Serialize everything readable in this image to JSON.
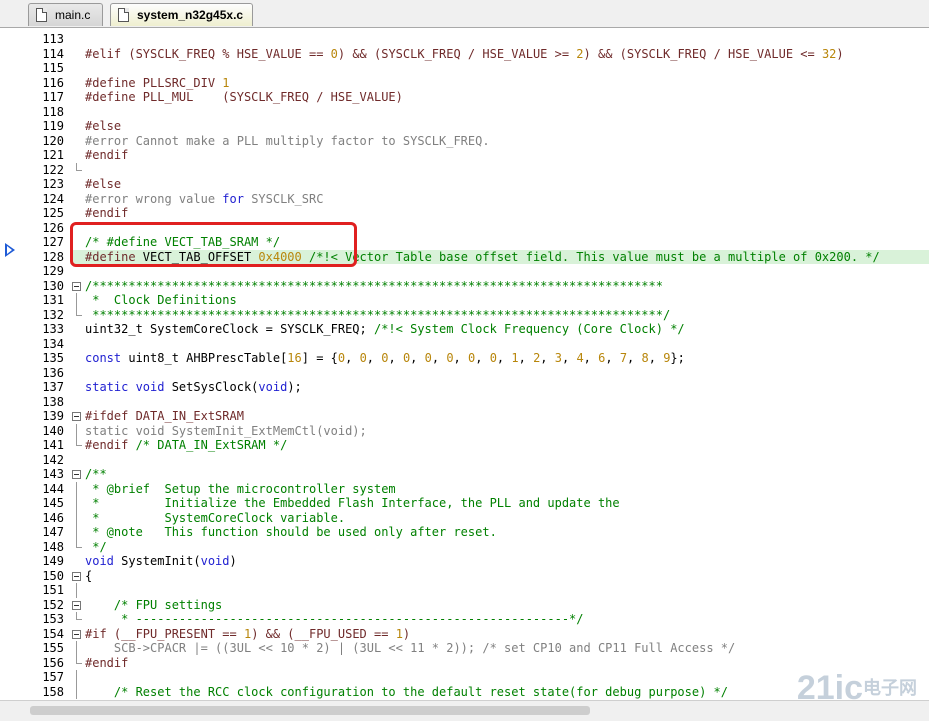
{
  "tabs": [
    {
      "label": "main.c",
      "active": false
    },
    {
      "label": "system_n32g45x.c",
      "active": true
    }
  ],
  "watermark": {
    "brand": "21ic",
    "cn": "电子网"
  },
  "highlight_line": 128,
  "lines": [
    {
      "n": "113",
      "segs": []
    },
    {
      "n": "114",
      "segs": [
        [
          "pp",
          "#elif (SYSCLK_FREQ % HSE_VALUE == "
        ],
        [
          "nm",
          "0"
        ],
        [
          "pp",
          ") && (SYSCLK_FREQ / HSE_VALUE >= "
        ],
        [
          "nm",
          "2"
        ],
        [
          "pp",
          ") && (SYSCLK_FREQ / HSE_VALUE <= "
        ],
        [
          "nm",
          "32"
        ],
        [
          "pp",
          ")"
        ]
      ]
    },
    {
      "n": "115",
      "segs": []
    },
    {
      "n": "116",
      "segs": [
        [
          "pp",
          "#define PLLSRC_DIV "
        ],
        [
          "nm",
          "1"
        ]
      ]
    },
    {
      "n": "117",
      "segs": [
        [
          "pp",
          "#define PLL_MUL    (SYSCLK_FREQ / HSE_VALUE)"
        ]
      ]
    },
    {
      "n": "118",
      "segs": []
    },
    {
      "n": "119",
      "segs": [
        [
          "pp",
          "#else"
        ]
      ]
    },
    {
      "n": "120",
      "segs": [
        [
          "gray",
          "#error Cannot make a PLL multiply factor to SYSCLK_FREQ."
        ]
      ]
    },
    {
      "n": "121",
      "segs": [
        [
          "pp",
          "#endif"
        ]
      ]
    },
    {
      "n": "122",
      "segs": []
    },
    {
      "n": "123",
      "segs": [
        [
          "pp",
          "#else"
        ]
      ]
    },
    {
      "n": "124",
      "segs": [
        [
          "gray",
          "#error wrong value "
        ],
        [
          "kw",
          "for"
        ],
        [
          "gray",
          " SYSCLK_SRC"
        ]
      ]
    },
    {
      "n": "125",
      "segs": [
        [
          "pp",
          "#endif"
        ]
      ]
    },
    {
      "n": "126",
      "segs": []
    },
    {
      "n": "127",
      "segs": [
        [
          "cm",
          "/* #define VECT_TAB_SRAM */"
        ]
      ]
    },
    {
      "n": "128",
      "segs": [
        [
          "pp",
          "#define "
        ],
        [
          "",
          "VECT_TAB_OFFSET "
        ],
        [
          "nm",
          "0x4000"
        ],
        [
          "cm",
          " /*!< Vector Table base offset field. This value must be a multiple of 0x200. */"
        ]
      ]
    },
    {
      "n": "129",
      "segs": []
    },
    {
      "n": "130",
      "segs": [
        [
          "cm",
          "/*******************************************************************************"
        ]
      ]
    },
    {
      "n": "131",
      "segs": [
        [
          "cm",
          " *  Clock Definitions"
        ]
      ]
    },
    {
      "n": "132",
      "segs": [
        [
          "cm",
          " *******************************************************************************/"
        ]
      ]
    },
    {
      "n": "133",
      "segs": [
        [
          "",
          "uint32_t SystemCoreClock = SYSCLK_FREQ; "
        ],
        [
          "cm",
          "/*!< System Clock Frequency (Core Clock) */"
        ]
      ]
    },
    {
      "n": "134",
      "segs": []
    },
    {
      "n": "135",
      "segs": [
        [
          "kw",
          "const"
        ],
        [
          "",
          " uint8_t AHBPrescTable["
        ],
        [
          "nm",
          "16"
        ],
        [
          "",
          "] = {"
        ],
        [
          "nm",
          "0"
        ],
        [
          "",
          ", "
        ],
        [
          "nm",
          "0"
        ],
        [
          "",
          ", "
        ],
        [
          "nm",
          "0"
        ],
        [
          "",
          ", "
        ],
        [
          "nm",
          "0"
        ],
        [
          "",
          ", "
        ],
        [
          "nm",
          "0"
        ],
        [
          "",
          ", "
        ],
        [
          "nm",
          "0"
        ],
        [
          "",
          ", "
        ],
        [
          "nm",
          "0"
        ],
        [
          "",
          ", "
        ],
        [
          "nm",
          "0"
        ],
        [
          "",
          ", "
        ],
        [
          "nm",
          "1"
        ],
        [
          "",
          ", "
        ],
        [
          "nm",
          "2"
        ],
        [
          "",
          ", "
        ],
        [
          "nm",
          "3"
        ],
        [
          "",
          ", "
        ],
        [
          "nm",
          "4"
        ],
        [
          "",
          ", "
        ],
        [
          "nm",
          "6"
        ],
        [
          "",
          ", "
        ],
        [
          "nm",
          "7"
        ],
        [
          "",
          ", "
        ],
        [
          "nm",
          "8"
        ],
        [
          "",
          ", "
        ],
        [
          "nm",
          "9"
        ],
        [
          "",
          "};"
        ]
      ]
    },
    {
      "n": "136",
      "segs": []
    },
    {
      "n": "137",
      "segs": [
        [
          "kw",
          "static void"
        ],
        [
          "",
          " SetSysClock("
        ],
        [
          "kw",
          "void"
        ],
        [
          "",
          ");"
        ]
      ]
    },
    {
      "n": "138",
      "segs": []
    },
    {
      "n": "139",
      "segs": [
        [
          "pp",
          "#ifdef DATA_IN_ExtSRAM"
        ]
      ]
    },
    {
      "n": "140",
      "segs": [
        [
          "gray",
          "static void SystemInit_ExtMemCtl(void);"
        ]
      ]
    },
    {
      "n": "141",
      "segs": [
        [
          "pp",
          "#endif "
        ],
        [
          "cm",
          "/* DATA_IN_ExtSRAM */"
        ]
      ]
    },
    {
      "n": "142",
      "segs": []
    },
    {
      "n": "143",
      "segs": [
        [
          "cm",
          "/**"
        ]
      ]
    },
    {
      "n": "144",
      "segs": [
        [
          "cm",
          " * @brief  Setup the microcontroller system"
        ]
      ]
    },
    {
      "n": "145",
      "segs": [
        [
          "cm",
          " *         Initialize the Embedded Flash Interface, the PLL and update the"
        ]
      ]
    },
    {
      "n": "146",
      "segs": [
        [
          "cm",
          " *         SystemCoreClock variable."
        ]
      ]
    },
    {
      "n": "147",
      "segs": [
        [
          "cm",
          " * @note   This function should be used only after reset."
        ]
      ]
    },
    {
      "n": "148",
      "segs": [
        [
          "cm",
          " */"
        ]
      ]
    },
    {
      "n": "149",
      "segs": [
        [
          "kw",
          "void"
        ],
        [
          "",
          " SystemInit("
        ],
        [
          "kw",
          "void"
        ],
        [
          "",
          ")"
        ]
      ]
    },
    {
      "n": "150",
      "segs": [
        [
          "",
          "{"
        ]
      ]
    },
    {
      "n": "151",
      "segs": []
    },
    {
      "n": "152",
      "segs": [
        [
          "cm",
          "    /* FPU settings"
        ]
      ]
    },
    {
      "n": "153",
      "segs": [
        [
          "cm",
          "     * ------------------------------------------------------------*/"
        ]
      ]
    },
    {
      "n": "154",
      "segs": [
        [
          "pp",
          "#if (__FPU_PRESENT == "
        ],
        [
          "nm",
          "1"
        ],
        [
          "pp",
          ") && (__FPU_USED == "
        ],
        [
          "nm",
          "1"
        ],
        [
          "pp",
          ")"
        ]
      ]
    },
    {
      "n": "155",
      "segs": [
        [
          "gray",
          "    SCB->CPACR |= ((3UL << 10 * 2) | (3UL << 11 * 2)); /* set CP10 and CP11 Full Access */"
        ]
      ]
    },
    {
      "n": "156",
      "segs": [
        [
          "pp",
          "#endif"
        ]
      ]
    },
    {
      "n": "157",
      "segs": []
    },
    {
      "n": "158",
      "segs": [
        [
          "cm",
          "    /* Reset the RCC clock configuration to the default reset state(for debug purpose) */"
        ]
      ]
    }
  ]
}
